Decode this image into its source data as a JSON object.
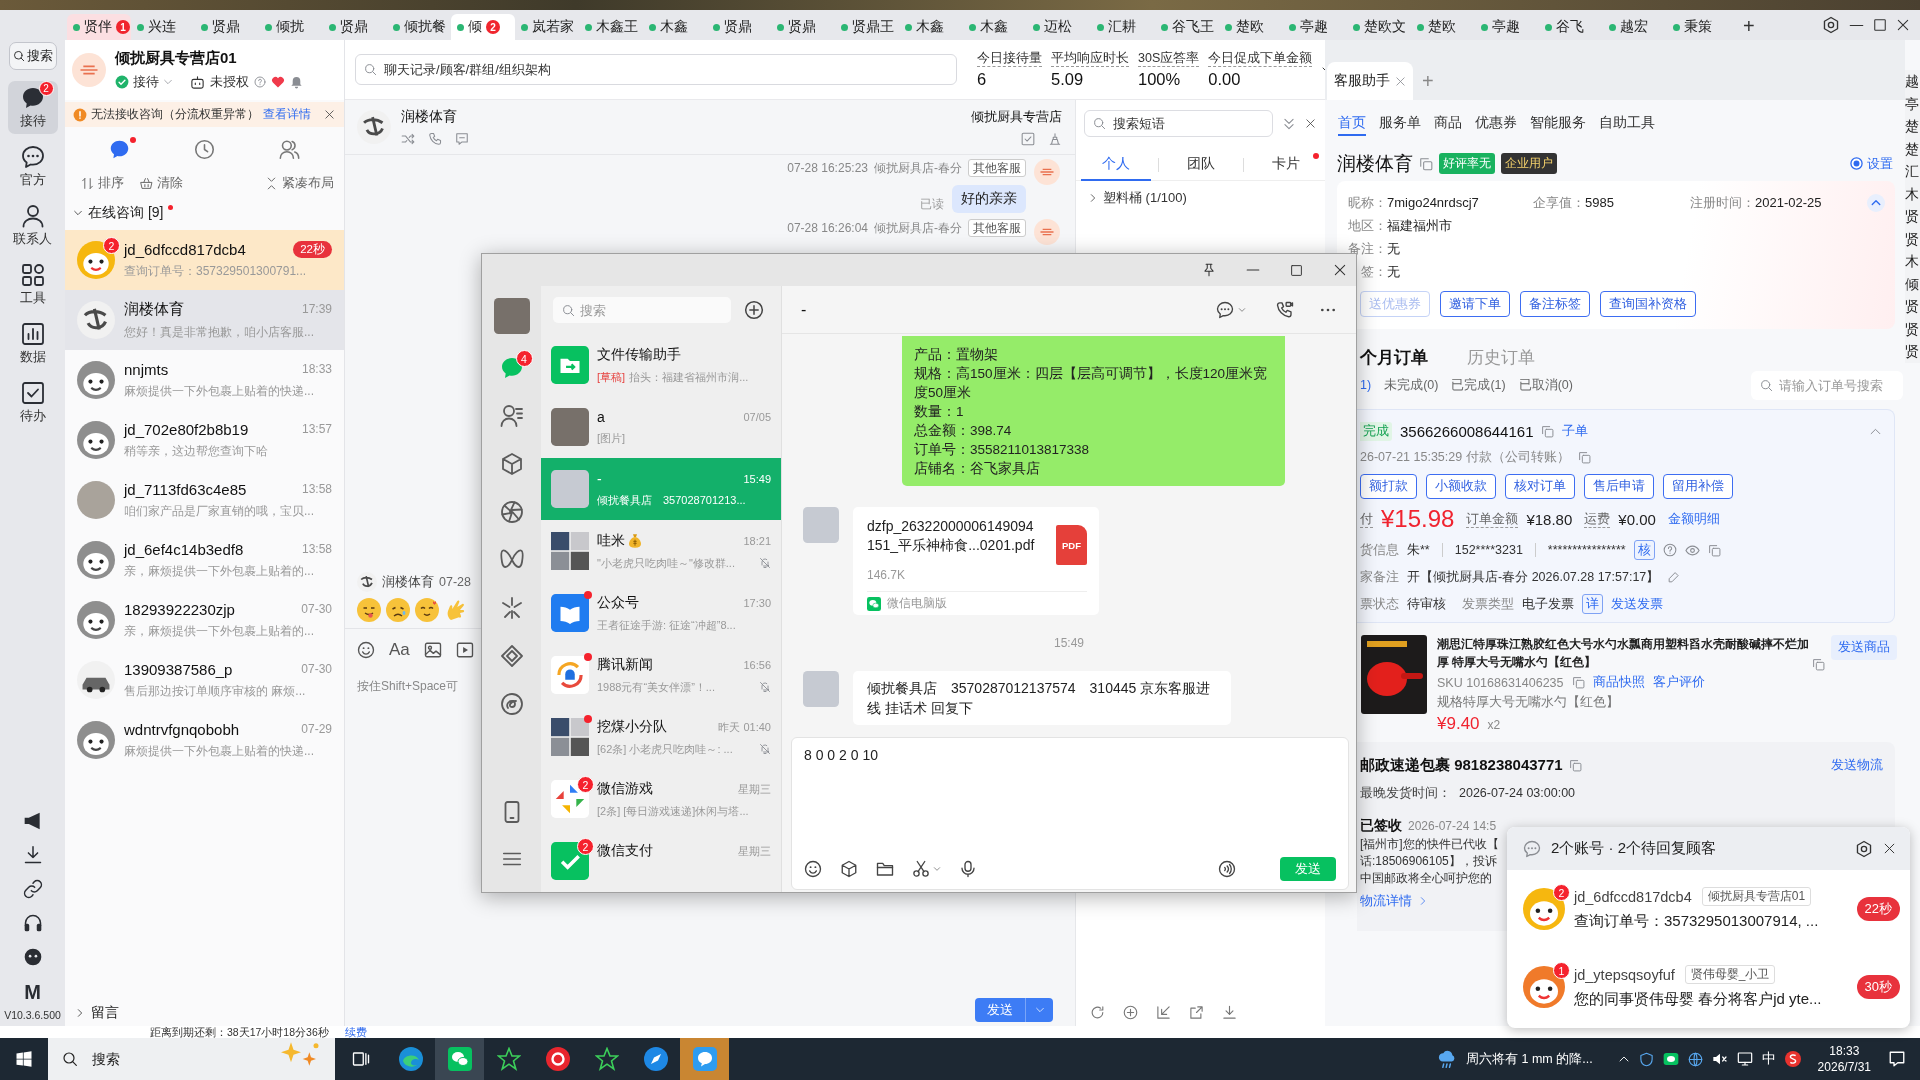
{
  "app_tabs": {
    "items": [
      {
        "label": "贤伴",
        "badge": "1",
        "online": true,
        "selected": false,
        "alert": true
      },
      {
        "label": "兴连",
        "online": true,
        "selected": false,
        "alert": false
      },
      {
        "label": "贤鼎",
        "online": true,
        "selected": false,
        "alert": false
      },
      {
        "label": "倾扰",
        "online": true,
        "selected": false,
        "alert": false
      },
      {
        "label": "贤鼎",
        "online": true,
        "selected": false,
        "alert": false
      },
      {
        "label": "倾扰餐",
        "online": true,
        "selected": false,
        "alert": false
      },
      {
        "label": "倾",
        "badge": "2",
        "online": true,
        "selected": true,
        "alert": false
      },
      {
        "label": "岚若家",
        "online": true,
        "selected": false,
        "alert": false
      },
      {
        "label": "木鑫王",
        "online": true,
        "selected": false,
        "alert": false
      },
      {
        "label": "木鑫",
        "online": true,
        "selected": false,
        "alert": false
      },
      {
        "label": "贤鼎",
        "online": true,
        "selected": false,
        "alert": false
      },
      {
        "label": "贤鼎",
        "online": true,
        "selected": false,
        "alert": false
      },
      {
        "label": "贤鼎王",
        "online": true,
        "selected": false,
        "alert": false
      },
      {
        "label": "木鑫",
        "online": true,
        "selected": false,
        "alert": false
      },
      {
        "label": "木鑫",
        "online": true,
        "selected": false,
        "alert": false
      },
      {
        "label": "迈松",
        "online": true,
        "selected": false,
        "alert": false
      },
      {
        "label": "汇耕",
        "online": true,
        "selected": false,
        "alert": false
      },
      {
        "label": "谷飞王",
        "online": true,
        "selected": false,
        "alert": false
      },
      {
        "label": "楚欧",
        "online": true,
        "selected": false,
        "alert": false
      },
      {
        "label": "亭趣",
        "online": true,
        "selected": false,
        "alert": false
      },
      {
        "label": "楚欧文",
        "online": true,
        "selected": false,
        "alert": false
      },
      {
        "label": "楚欧",
        "online": true,
        "selected": false,
        "alert": false
      },
      {
        "label": "亭趣",
        "online": true,
        "selected": false,
        "alert": false
      },
      {
        "label": "谷飞",
        "online": true,
        "selected": false,
        "alert": false
      },
      {
        "label": "越宏",
        "online": true,
        "selected": false,
        "alert": false
      },
      {
        "label": "秉策",
        "online": true,
        "selected": false,
        "alert": false
      }
    ],
    "add": "+"
  },
  "tab_overflow": [
    "越",
    "亭",
    "楚",
    "楚",
    "汇",
    "木",
    "贤",
    "贤",
    "木",
    "倾",
    "贤",
    "贤",
    "贤"
  ],
  "nav_rail": {
    "search": "搜索",
    "items": [
      {
        "label": "接待",
        "badge": "2",
        "selected": true
      },
      {
        "label": "官方",
        "selected": false
      },
      {
        "label": "联系人",
        "selected": false
      },
      {
        "label": "工具",
        "selected": false
      },
      {
        "label": "数据",
        "selected": false
      },
      {
        "label": "待办",
        "selected": false
      }
    ],
    "brand": "M",
    "version": "V10.3.6.500"
  },
  "shop": {
    "name": "倾扰厨具专营店01",
    "status": "接待",
    "online": true,
    "auth": "未授权"
  },
  "notice": {
    "text": "无法接收咨询（分流权重异常）",
    "link": "查看详情"
  },
  "list_tabs": [
    {
      "selected": true,
      "dot": true
    },
    {
      "selected": false,
      "dot": false
    },
    {
      "selected": false,
      "dot": false
    }
  ],
  "list_actions": [
    "排序",
    "清除",
    "紧凑布局"
  ],
  "queue": {
    "label": "在线咨询 [9]",
    "expanded": true,
    "dot": true,
    "items": [
      {
        "name": "jd_6dfccd817dcb4",
        "timer": "22秒",
        "preview": "查询订单号：357329501300791...",
        "badge": "2",
        "pending": true,
        "selected": false
      },
      {
        "name": "润楼体育",
        "time": "17:39",
        "preview": "您好！真是非常抱歉，咱小店客服...",
        "pending": false,
        "selected": true
      },
      {
        "name": "nnjmts",
        "time": "18:33",
        "preview": "麻烦提供一下外包裹上贴着的快递...",
        "pending": false,
        "selected": false
      },
      {
        "name": "jd_702e80f2b8b19",
        "time": "13:57",
        "preview": "稍等亲，这边帮您查询下哈",
        "pending": false,
        "selected": false
      },
      {
        "name": "jd_7113fd63c4e85",
        "time": "13:58",
        "preview": "咱们家产品是厂家直销的哦，宝贝...",
        "pending": false,
        "selected": false
      },
      {
        "name": "jd_6ef4c14b3edf8",
        "time": "13:58",
        "preview": "亲，麻烦提供一下外包裹上贴着的...",
        "pending": false,
        "selected": false
      },
      {
        "name": "18293922230zjp",
        "time": "07-30",
        "preview": "亲，麻烦提供一下外包裹上贴着的...",
        "pending": false,
        "selected": false
      },
      {
        "name": "13909387586_p",
        "time": "07-30",
        "preview": "售后那边按订单顺序审核的 麻烦...",
        "pending": false,
        "selected": false
      },
      {
        "name": "wdntrvfgnqobobh",
        "time": "07-29",
        "preview": "麻烦提供一下外包裹上贴着的快递...",
        "pending": false,
        "selected": false
      }
    ]
  },
  "messages_folder": {
    "label": "留言",
    "expanded": false
  },
  "expiry": {
    "text": "距离到期还剩：38天17小时18分36秒",
    "link": "续费"
  },
  "chat_search": {
    "placeholder": "聊天记录/顾客/群组/组织架构"
  },
  "stats": [
    {
      "label": "今日接待量",
      "value": "6"
    },
    {
      "label": "平均响应时长",
      "value": "5.09"
    },
    {
      "label": "30S应答率",
      "value": "100%"
    },
    {
      "label": "今日促成下单金额",
      "value": "0.00"
    }
  ],
  "chat": {
    "customer": "润楼体育",
    "shop": "倾扰厨具专营店",
    "messages": [
      {
        "time": "07-28 16:25:23",
        "sender": "倾扰厨具店-春分",
        "tag": "其他客服",
        "text": "好的亲亲",
        "read": "已读"
      },
      {
        "time": "07-28 16:26:04",
        "sender": "倾扰厨具店-春分",
        "tag": "其他客服"
      }
    ],
    "incoming": {
      "sender": "润楼体育",
      "time": "07-28"
    },
    "font_tool": "Aa",
    "placeholder": "按住Shift+Space可",
    "send": "发送"
  },
  "phrases": {
    "placeholder": "搜索短语",
    "tabs": [
      {
        "label": "个人",
        "selected": true,
        "dot": false
      },
      {
        "label": "团队",
        "selected": false,
        "dot": false
      },
      {
        "label": "卡片",
        "selected": false,
        "dot": true
      }
    ],
    "groups": [
      {
        "label": "塑料桶 (1/100)",
        "expanded": false
      }
    ]
  },
  "wechat": {
    "search": {
      "placeholder": "搜索"
    },
    "nav": [
      {
        "selected": true,
        "badge": "4"
      },
      {
        "selected": false
      },
      {
        "selected": false
      },
      {
        "selected": false
      },
      {
        "selected": false
      },
      {
        "selected": false
      },
      {
        "selected": false
      },
      {
        "selected": false
      }
    ],
    "chats": [
      {
        "name": "文件传输助手",
        "draft": "[草稿]",
        "preview": "抬头：福建省福州市润...",
        "selected": false,
        "muted": false,
        "dot": false
      },
      {
        "name": "a",
        "time": "07/05",
        "preview": "[图片]",
        "selected": false,
        "muted": false,
        "dot": false
      },
      {
        "name": "-",
        "time": "15:49",
        "preview": "倾扰餐具店　357028701213...",
        "selected": true,
        "muted": false,
        "dot": false
      },
      {
        "name": "哇米",
        "time": "18:21",
        "preview": "\"小老虎只吃肉哇～\"修改群...",
        "selected": false,
        "muted": true,
        "dot": false
      },
      {
        "name": "公众号",
        "time": "17:30",
        "preview": "王者征途手游: 征途“冲超”8...",
        "selected": false,
        "muted": false,
        "dot": true
      },
      {
        "name": "腾讯新闻",
        "time": "16:56",
        "preview": "1988元有“美女伴漂”！...",
        "selected": false,
        "muted": true,
        "dot": true
      },
      {
        "name": "挖煤小分队",
        "time": "昨天 01:40",
        "preview": "[62条] 小老虎只吃肉哇～: ...",
        "selected": false,
        "muted": true,
        "dot": true
      },
      {
        "name": "微信游戏",
        "time": "星期三",
        "preview": "[2条] [每日游戏速递]休闲与塔...",
        "badge": "2",
        "selected": false,
        "muted": false,
        "dot": false
      },
      {
        "name": "微信支付",
        "time": "星期三",
        "badge": "2",
        "selected": false,
        "muted": false,
        "dot": false
      }
    ],
    "title": "-",
    "messages": [
      {
        "kind": "order",
        "lines": [
          "产品：置物架",
          "规格：高150厘米：四层【层高可调节】，长度120厘米宽度50厘米",
          "数量：1",
          "总金额：398.74",
          "订单号：3558211013817338",
          "店铺名：谷飞家具店"
        ]
      },
      {
        "kind": "file",
        "name": "dzfp_26322000006149094151_平乐神柿食...0201.pdf",
        "type": "PDF",
        "size": "146.7K",
        "source": "微信电脑版"
      },
      {
        "kind": "time",
        "text": "15:49"
      },
      {
        "kind": "text",
        "text": "倾扰餐具店　3570287012137574　310445 京东客服进线 挂话术 回复下"
      }
    ],
    "input": {
      "value": "8 0 0 2 0 10"
    },
    "send": "发送"
  },
  "assistant": {
    "tab": {
      "label": "客服助手",
      "selected": true
    },
    "add": "+",
    "nav": [
      {
        "label": "首页",
        "selected": true
      },
      {
        "label": "服务单",
        "selected": false
      },
      {
        "label": "商品",
        "selected": false
      },
      {
        "label": "优惠券",
        "selected": false
      },
      {
        "label": "智能服务",
        "selected": false
      },
      {
        "label": "自助工具",
        "selected": false
      }
    ],
    "customer": "润楼体育",
    "tags": [
      {
        "label": "好评率无",
        "color": "#19b25f"
      },
      {
        "label": "企业用户",
        "color": "#333333"
      }
    ],
    "setting": {
      "label": "设置",
      "checked": true
    },
    "info": [
      [
        {
          "label": "昵称：",
          "value": "7migo24nrdscj7"
        },
        {
          "label": "企享值：",
          "value": "5985"
        },
        {
          "label": "注册时间：",
          "value": "2021-02-25"
        }
      ],
      [
        {
          "label": "地区：",
          "value": "福建福州市"
        }
      ],
      [
        {
          "label": "备注：",
          "value": "无"
        }
      ],
      [
        {
          "label": "签：",
          "value": "无"
        }
      ]
    ],
    "actions": [
      {
        "label": "送优惠券",
        "disabled": true
      },
      {
        "label": "邀请下单",
        "disabled": false
      },
      {
        "label": "备注标签",
        "disabled": false
      },
      {
        "label": "查询国补资格",
        "disabled": false
      }
    ],
    "order_tabs": [
      {
        "label": "个月订单",
        "selected": true
      },
      {
        "label": "历史订单",
        "selected": false
      }
    ],
    "filters": [
      {
        "label": "1)",
        "selected": true
      },
      {
        "label": "未完成(0)",
        "selected": false
      },
      {
        "label": "已完成(1)",
        "selected": false
      },
      {
        "label": "已取消(0)",
        "selected": false
      }
    ],
    "order_search": {
      "placeholder": "请输入订单号搜索"
    },
    "order": {
      "status": "完成",
      "number": "3566266008644161",
      "sub": "子单",
      "paid_time": "26-07-21 15:35:29 付款（公司转账）",
      "actions": [
        "额打款",
        "小额收款",
        "核对订单",
        "售后申请",
        "留用补偿"
      ],
      "paid_label": "付",
      "paid": "¥15.98",
      "total_label": "订单金额",
      "total": "¥18.80",
      "freight_label": "运费",
      "freight": "¥0.00",
      "detail": "金额明细",
      "receiver_label": "货信息",
      "receiver": "朱**",
      "phone": "152****3231",
      "address": "****************",
      "verify": "核",
      "remark_label": "家备注",
      "remark": "开【倾扰厨具店-春分 2026.07.28 17:57:17】",
      "invoice_label": "票状态",
      "invoice_status": "待审核",
      "invoice_type_label": "发票类型",
      "invoice_type": "电子发票",
      "invoice_detail": "详",
      "send_invoice": "发送发票"
    },
    "product": {
      "title": "潮思汇特厚珠江熟胶红色大号水勺水瓢商用塑料舀水壳耐酸碱摔不烂加厚 特厚大号无嘴水勺【红色】",
      "send": "发送商品",
      "sku": "SKU 10168631406235",
      "snapshot": "商品快照",
      "review": "客户评价",
      "spec": "规格特厚大号无嘴水勺【红色】",
      "price": "¥9.40",
      "qty": "x2"
    },
    "logistics": {
      "carrier": "邮政速递包裹 9818238043771",
      "send": "发送物流",
      "deadline_label": "最晚发货时间：",
      "deadline": "2026-07-24 03:00:00",
      "status": "已签收",
      "status_time": "2026-07-24 14:5",
      "lines": [
        "[福州市]您的快件已代收【",
        "话:18506906105】，投诉",
        "中国邮政将全心呵护您的"
      ],
      "detail": "物流详情"
    }
  },
  "popup": {
    "title": "2个账号 · 2个待回复顾客",
    "items": [
      {
        "name": "jd_6dfccd817dcb4",
        "badge": "2",
        "shop": "倾扰厨具专营店01",
        "message": "查询订单号：3573295013007914, ...",
        "timer": "22秒"
      },
      {
        "name": "jd_ytepsqsoyfuf",
        "badge": "1",
        "shop": "贤伟母婴_小卫",
        "message": "您的同事贤伟母婴 春分将客户jd yte...",
        "timer": "30秒"
      }
    ]
  },
  "taskbar": {
    "search": {
      "placeholder": "搜索"
    },
    "apps": [
      {
        "selected": false,
        "flashing": false
      },
      {
        "selected": true,
        "flashing": false
      },
      {
        "selected": false,
        "flashing": false
      },
      {
        "selected": false,
        "flashing": false
      },
      {
        "selected": false,
        "flashing": false
      },
      {
        "selected": false,
        "flashing": false
      },
      {
        "selected": false,
        "flashing": true
      }
    ],
    "weather": "周六将有 1 mm 的降...",
    "ime": "中",
    "time": "18:33",
    "date": "2026/7/31"
  }
}
